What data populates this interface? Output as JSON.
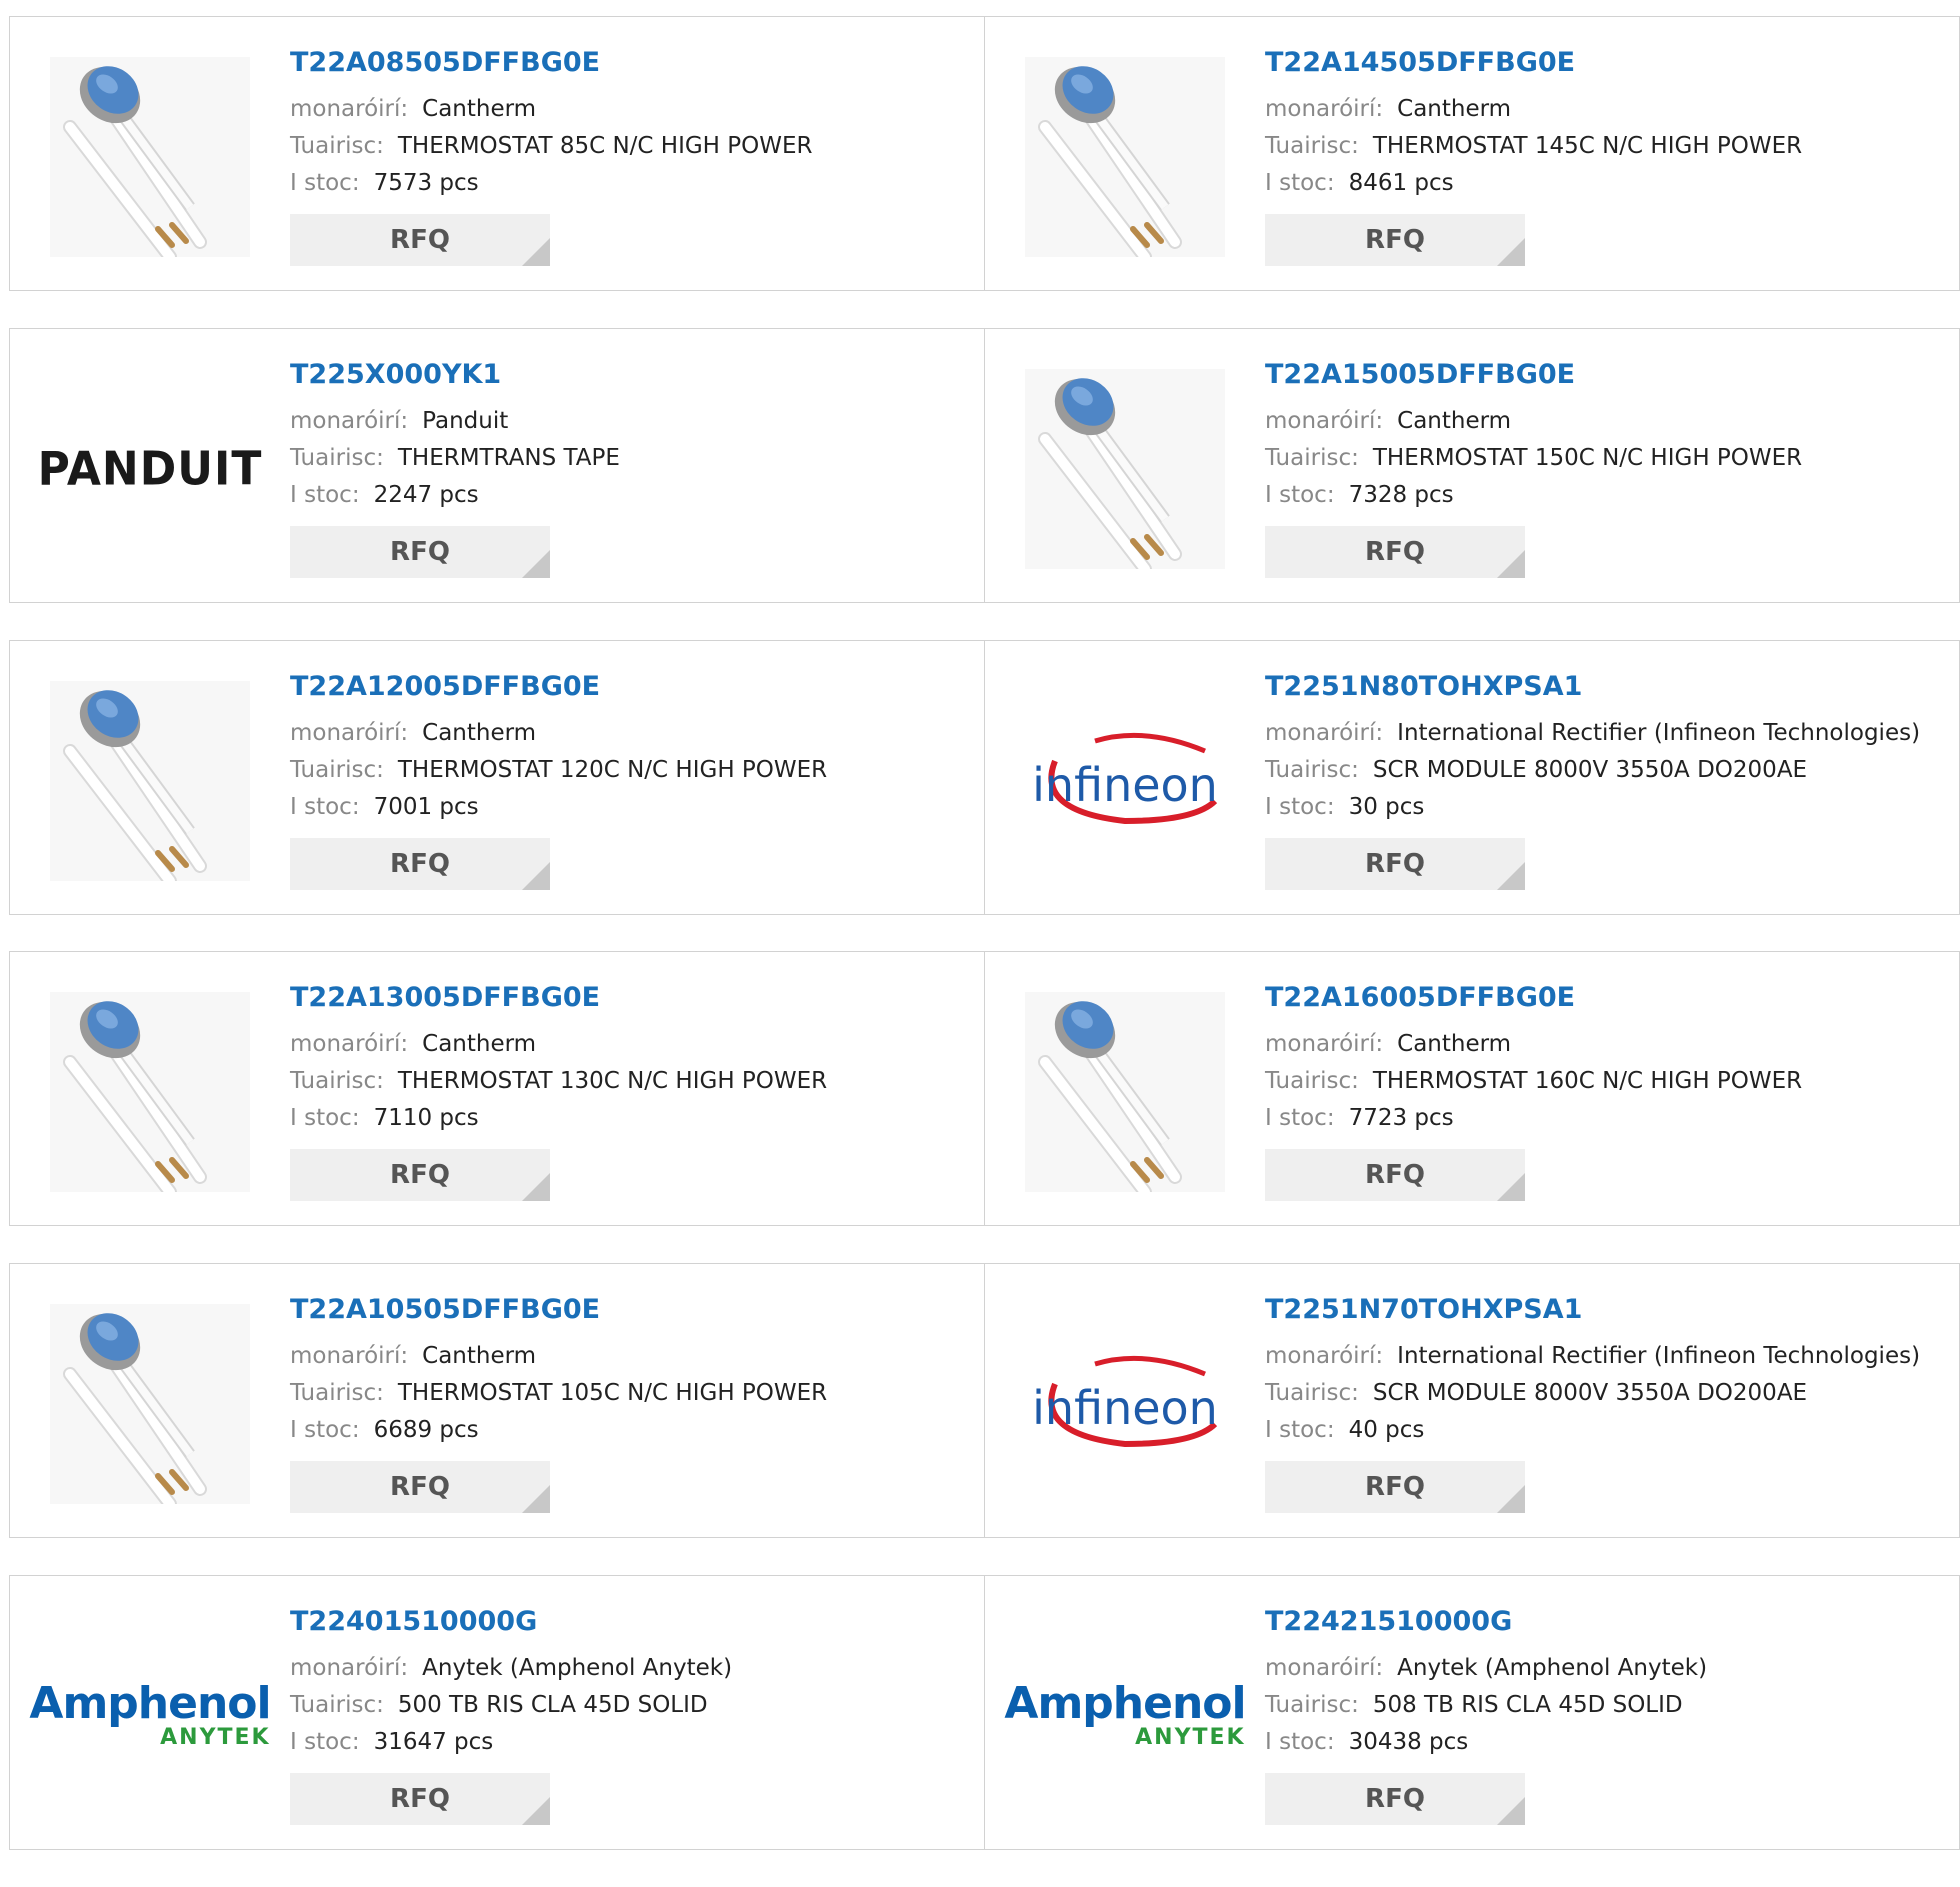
{
  "labels": {
    "mfr": "monaróirí:",
    "desc": "Tuairisc:",
    "stock": "I stoc:",
    "rfq": "RFQ"
  },
  "products": [
    {
      "pn": "T22A08505DFFBG0E",
      "mfr": "Cantherm",
      "desc": "THERMOSTAT 85C N/C HIGH POWER",
      "stock": "7573 pcs",
      "image": "thermostat-image"
    },
    {
      "pn": "T22A14505DFFBG0E",
      "mfr": "Cantherm",
      "desc": "THERMOSTAT 145C N/C HIGH POWER",
      "stock": "8461 pcs",
      "image": "thermostat-image"
    },
    {
      "pn": "T225X000YK1",
      "mfr": "Panduit",
      "desc": "THERMTRANS TAPE",
      "stock": "2247 pcs",
      "image": "panduit-logo",
      "logo_text": "PANDUIT"
    },
    {
      "pn": "T22A15005DFFBG0E",
      "mfr": "Cantherm",
      "desc": "THERMOSTAT 150C N/C HIGH POWER",
      "stock": "7328 pcs",
      "image": "thermostat-image"
    },
    {
      "pn": "T22A12005DFFBG0E",
      "mfr": "Cantherm",
      "desc": "THERMOSTAT 120C N/C HIGH POWER",
      "stock": "7001 pcs",
      "image": "thermostat-image"
    },
    {
      "pn": "T2251N80TOHXPSA1",
      "mfr": "International Rectifier (Infineon Technologies)",
      "desc": "SCR MODULE 8000V 3550A DO200AE",
      "stock": "30 pcs",
      "image": "infineon-logo",
      "logo_text": "infineon"
    },
    {
      "pn": "T22A13005DFFBG0E",
      "mfr": "Cantherm",
      "desc": "THERMOSTAT 130C N/C HIGH POWER",
      "stock": "7110 pcs",
      "image": "thermostat-image"
    },
    {
      "pn": "T22A16005DFFBG0E",
      "mfr": "Cantherm",
      "desc": "THERMOSTAT 160C N/C HIGH POWER",
      "stock": "7723 pcs",
      "image": "thermostat-image"
    },
    {
      "pn": "T22A10505DFFBG0E",
      "mfr": "Cantherm",
      "desc": "THERMOSTAT 105C N/C HIGH POWER",
      "stock": "6689 pcs",
      "image": "thermostat-image"
    },
    {
      "pn": "T2251N70TOHXPSA1",
      "mfr": "International Rectifier (Infineon Technologies)",
      "desc": "SCR MODULE 8000V 3550A DO200AE",
      "stock": "40 pcs",
      "image": "infineon-logo",
      "logo_text": "infineon"
    },
    {
      "pn": "T22401510000G",
      "mfr": "Anytek (Amphenol Anytek)",
      "desc": "500 TB RIS CLA 45D SOLID",
      "stock": "31647 pcs",
      "image": "amphenol-logo",
      "logo_text": "Amphenol",
      "logo_sub": "ANYTEK"
    },
    {
      "pn": "T22421510000G",
      "mfr": "Anytek (Amphenol Anytek)",
      "desc": "508 TB RIS CLA 45D SOLID",
      "stock": "30438 pcs",
      "image": "amphenol-logo",
      "logo_text": "Amphenol",
      "logo_sub": "ANYTEK"
    }
  ],
  "colors": {
    "link": "#1a6fb8",
    "label": "#888888",
    "button_bg": "#efefef",
    "border": "#d2d2d2",
    "thermostat_blue": "#4f86c6",
    "infineon_red": "#d81e2a",
    "amphenol_blue": "#0a5fae",
    "amphenol_green": "#2c9a3c"
  }
}
